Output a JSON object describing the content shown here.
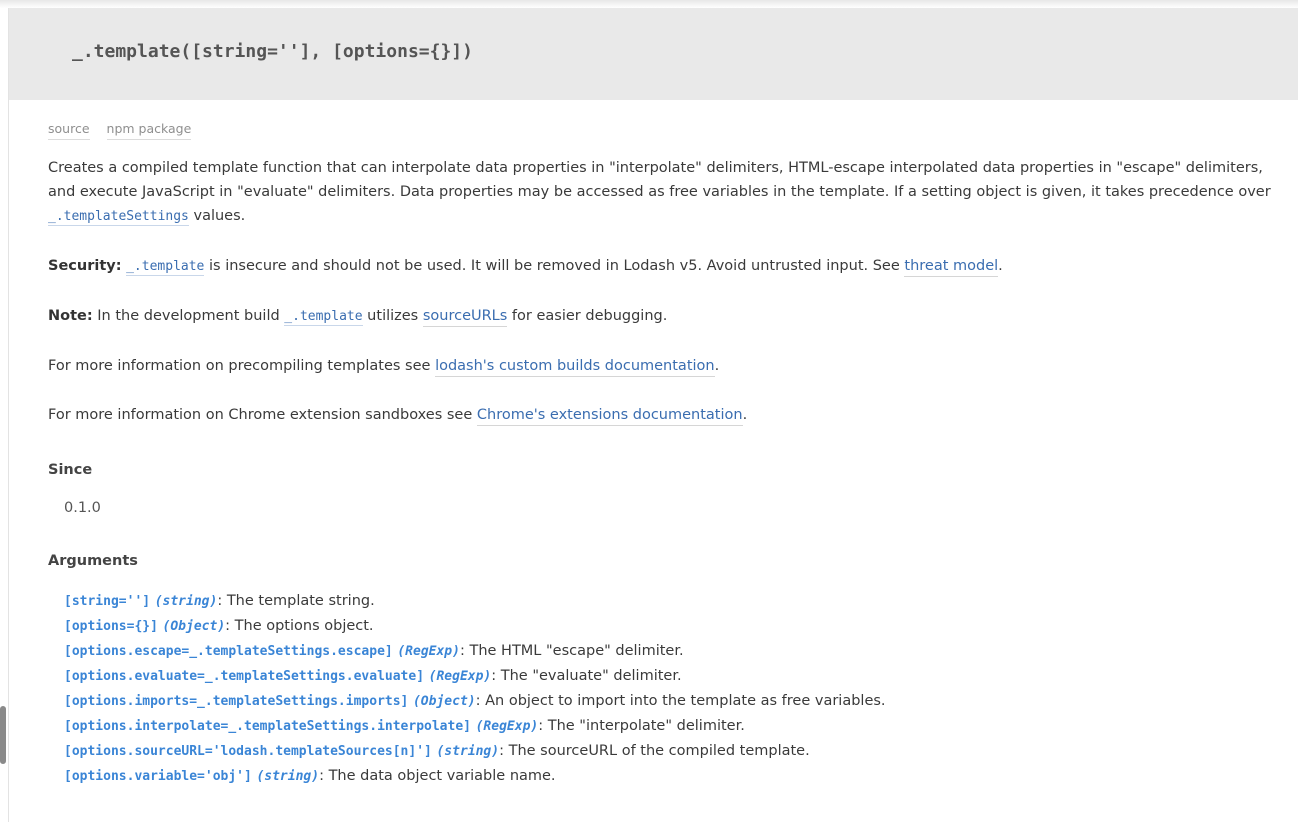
{
  "signature": "_.template([string=''], [options={}])",
  "meta": {
    "source_label": "source",
    "npm_label": "npm package"
  },
  "description": {
    "text_before": "Creates a compiled template function that can interpolate data properties in \"interpolate\" delimiters, HTML-escape interpolated data properties in \"escape\" delimiters, and execute JavaScript in \"evaluate\" delimiters. Data properties may be accessed as free variables in the template. If a setting object is given, it takes precedence over ",
    "code": "_.templateSettings",
    "text_after": " values."
  },
  "security": {
    "label": "Security:",
    "code": "_.template",
    "text": " is insecure and should not be used. It will be removed in Lodash v5. Avoid untrusted input. See ",
    "link": "threat model",
    "end": "."
  },
  "note": {
    "label": "Note:",
    "text_before": " In the development build ",
    "code": "_.template",
    "text_mid": " utilizes ",
    "link": "sourceURLs",
    "text_after": " for easier debugging."
  },
  "precompile": {
    "text": "For more information on precompiling templates see ",
    "link": "lodash's custom builds documentation",
    "end": "."
  },
  "chrome": {
    "text": "For more information on Chrome extension sandboxes see ",
    "link": "Chrome's extensions documentation",
    "end": "."
  },
  "since": {
    "heading": "Since",
    "version": "0.1.0"
  },
  "arguments": {
    "heading": "Arguments",
    "items": [
      {
        "name": "[string='']",
        "type": "(string)",
        "desc": ": The template string."
      },
      {
        "name": "[options={}]",
        "type": "(Object)",
        "desc": ": The options object."
      },
      {
        "name": "[options.escape=_.templateSettings.escape]",
        "type": "(RegExp)",
        "desc": ": The HTML \"escape\" delimiter."
      },
      {
        "name": "[options.evaluate=_.templateSettings.evaluate]",
        "type": "(RegExp)",
        "desc": ": The \"evaluate\" delimiter."
      },
      {
        "name": "[options.imports=_.templateSettings.imports]",
        "type": "(Object)",
        "desc": ": An object to import into the template as free variables."
      },
      {
        "name": "[options.interpolate=_.templateSettings.interpolate]",
        "type": "(RegExp)",
        "desc": ": The \"interpolate\" delimiter."
      },
      {
        "name": "[options.sourceURL='lodash.templateSources[n]']",
        "type": "(string)",
        "desc": ": The sourceURL of the compiled template."
      },
      {
        "name": "[options.variable='obj']",
        "type": "(string)",
        "desc": ": The data object variable name."
      }
    ]
  }
}
